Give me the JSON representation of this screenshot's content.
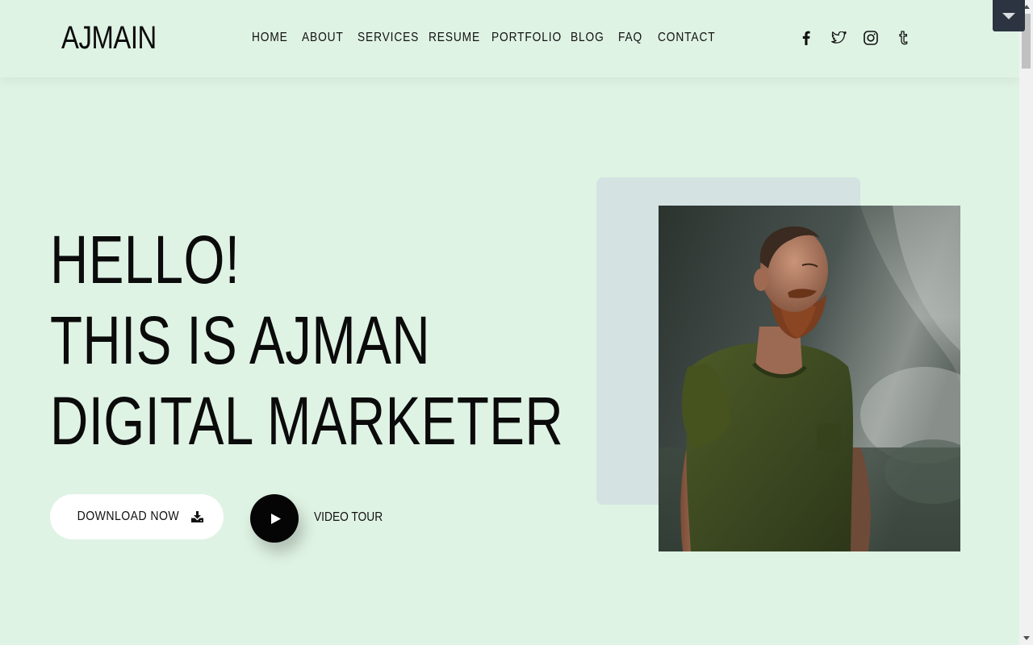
{
  "header": {
    "logo": "AJMAIN",
    "nav": [
      {
        "label": "HOME"
      },
      {
        "label": "ABOUT"
      },
      {
        "label": "SERVICES"
      },
      {
        "label": "RESUME"
      },
      {
        "label": "PORTFOLIO"
      },
      {
        "label": "BLOG"
      },
      {
        "label": "FAQ"
      },
      {
        "label": "CONTACT"
      }
    ],
    "social_icons": [
      "facebook-icon",
      "twitter-icon",
      "instagram-icon",
      "tumblr-icon"
    ]
  },
  "hero": {
    "line1": "HELLO!",
    "line2": "THIS IS AJMAN",
    "line3": "DIGITAL MARKETER",
    "download_label": "DOWNLOAD NOW",
    "download_icon": "download-icon",
    "play_icon": "play-icon",
    "video_label": "VIDEO TOUR"
  },
  "colors": {
    "background": "#dff3e4",
    "photo_backdrop": "#d4e2e2",
    "toggle_button": "#2b3440",
    "play_button": "#050505",
    "download_button": "#ffffff"
  }
}
